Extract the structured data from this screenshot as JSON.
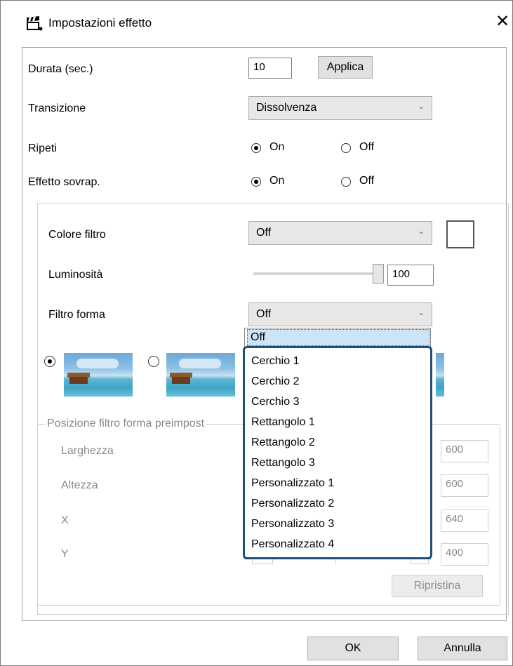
{
  "window": {
    "title": "Impostazioni effetto",
    "icon": "clapperboard-icon",
    "close_glyph": "✕"
  },
  "settings": {
    "duration_label": "Durata (sec.)",
    "duration_value": "10",
    "apply_button": "Applica",
    "transition_label": "Transizione",
    "transition_value": "Dissolvenza",
    "repeat_label": "Ripeti",
    "repeat_on": "On",
    "repeat_off": "Off",
    "repeat_selected": "On",
    "overlap_label": "Effetto sovrap.",
    "overlap_on": "On",
    "overlap_off": "Off",
    "overlap_selected": "On"
  },
  "filter": {
    "color_label": "Colore filtro",
    "color_value": "Off",
    "brightness_label": "Luminosità",
    "brightness_value": "100",
    "brightness_level_percent": 100,
    "shape_label": "Filtro forma",
    "shape_value": "Off"
  },
  "preset_position": {
    "legend": "Posizione filtro forma preimpost",
    "width_label": "Larghezza",
    "width_value": "600",
    "height_label": "Altezza",
    "height_value": "600",
    "x_label": "X",
    "x_value": "640",
    "y_label": "Y",
    "y_value": "400",
    "reset_button": "Ripristina"
  },
  "dropdown": {
    "highlighted": "Off",
    "items": [
      "Cerchio 1",
      "Cerchio 2",
      "Cerchio 3",
      "Rettangolo 1",
      "Rettangolo 2",
      "Rettangolo 3",
      "Personalizzato 1",
      "Personalizzato 2",
      "Personalizzato 3",
      "Personalizzato 4"
    ]
  },
  "footer": {
    "ok_button": "OK",
    "cancel_button": "Annulla"
  },
  "colors": {
    "highlight_border": "#1f4e79",
    "selected_item_bg": "#cce4f7"
  }
}
